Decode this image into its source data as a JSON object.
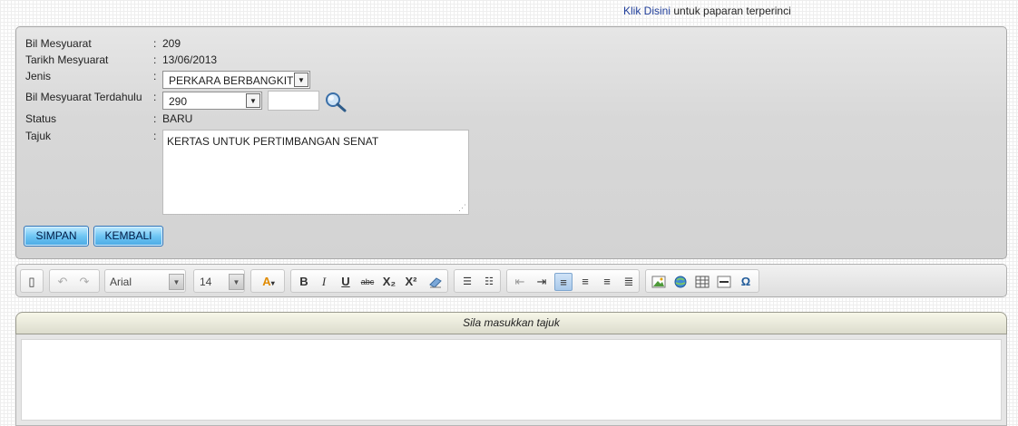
{
  "toplink": {
    "link_text": "Klik Disini",
    "rest_text": " untuk paparan terperinci"
  },
  "form": {
    "bil_mesyuarat": {
      "label": "Bil Mesyuarat",
      "value": "209"
    },
    "tarikh_mesyuarat": {
      "label": "Tarikh Mesyuarat",
      "value": "13/06/2013"
    },
    "jenis": {
      "label": "Jenis",
      "value": "PERKARA BERBANGKIT"
    },
    "bil_terdahulu": {
      "label": "Bil Mesyuarat Terdahulu",
      "value": "290",
      "extra_value": ""
    },
    "status": {
      "label": "Status",
      "value": "BARU"
    },
    "tajuk": {
      "label": "Tajuk",
      "value": "KERTAS UNTUK PERTIMBANGAN SENAT"
    },
    "colon": ":"
  },
  "buttons": {
    "simpan": "SIMPAN",
    "kembali": "KEMBALI"
  },
  "toolbar": {
    "font": "Arial",
    "size": "14",
    "bold": "B",
    "italic": "I",
    "underline": "U",
    "strike": "abc",
    "subscript": "X₂",
    "superscript": "X²",
    "special_char": "Ω"
  },
  "editor": {
    "header": "Sila masukkan tajuk",
    "content": ""
  },
  "icons": [
    "magnifier-icon",
    "new-document-icon",
    "undo-icon",
    "redo-icon",
    "font-color-icon",
    "eraser-icon",
    "ordered-list-icon",
    "unordered-list-icon",
    "outdent-icon",
    "indent-icon",
    "align-left-icon",
    "align-center-icon",
    "align-right-icon",
    "justify-icon",
    "image-icon",
    "link-icon",
    "table-icon",
    "horizontal-rule-icon"
  ],
  "colors": {
    "link": "#1f3d99",
    "button": "#6fc6f4",
    "panel": "#d8d8d8"
  }
}
